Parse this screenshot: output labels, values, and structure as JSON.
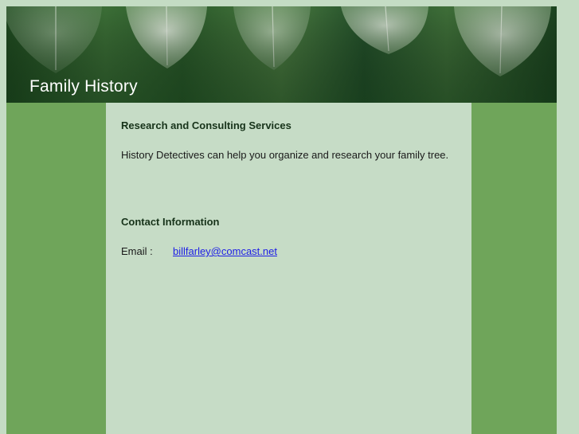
{
  "header": {
    "title": "Family History"
  },
  "main": {
    "services_heading": "Research and Consulting Services",
    "services_text": "History Detectives can help you organize and research your family tree.",
    "contact_heading": "Contact Information",
    "email_label": "Email :",
    "email_value": "billfarley@comcast.net"
  },
  "colors": {
    "page_background": "#c4dcc4",
    "side_column": "#6fa55a",
    "content_background": "#c6dcc6",
    "heading_text": "#17331a",
    "link": "#1e1ee6"
  }
}
